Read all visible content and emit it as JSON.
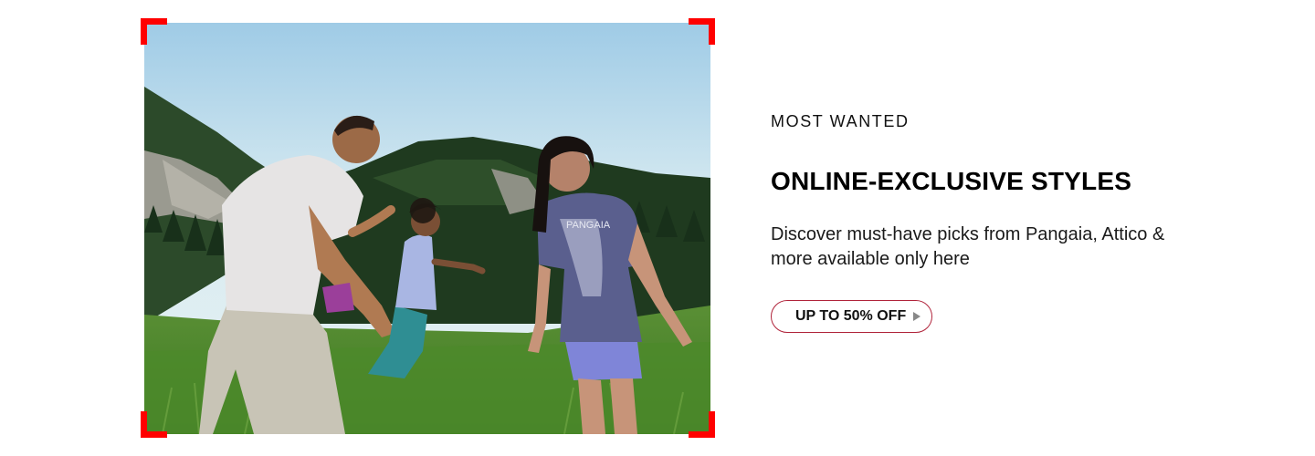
{
  "promo": {
    "eyebrow": "MOST WANTED",
    "headline": "ONLINE-EXCLUSIVE STYLES",
    "description": "Discover must-have picks from Pangaia, Attico & more available only here",
    "cta_label": "UP TO 50% OFF",
    "cta_icon": "play-triangle-icon",
    "accent_color": "#ff0000",
    "cta_border_color": "#b0233a"
  },
  "photo": {
    "shirt_print": "PANGAIA"
  }
}
